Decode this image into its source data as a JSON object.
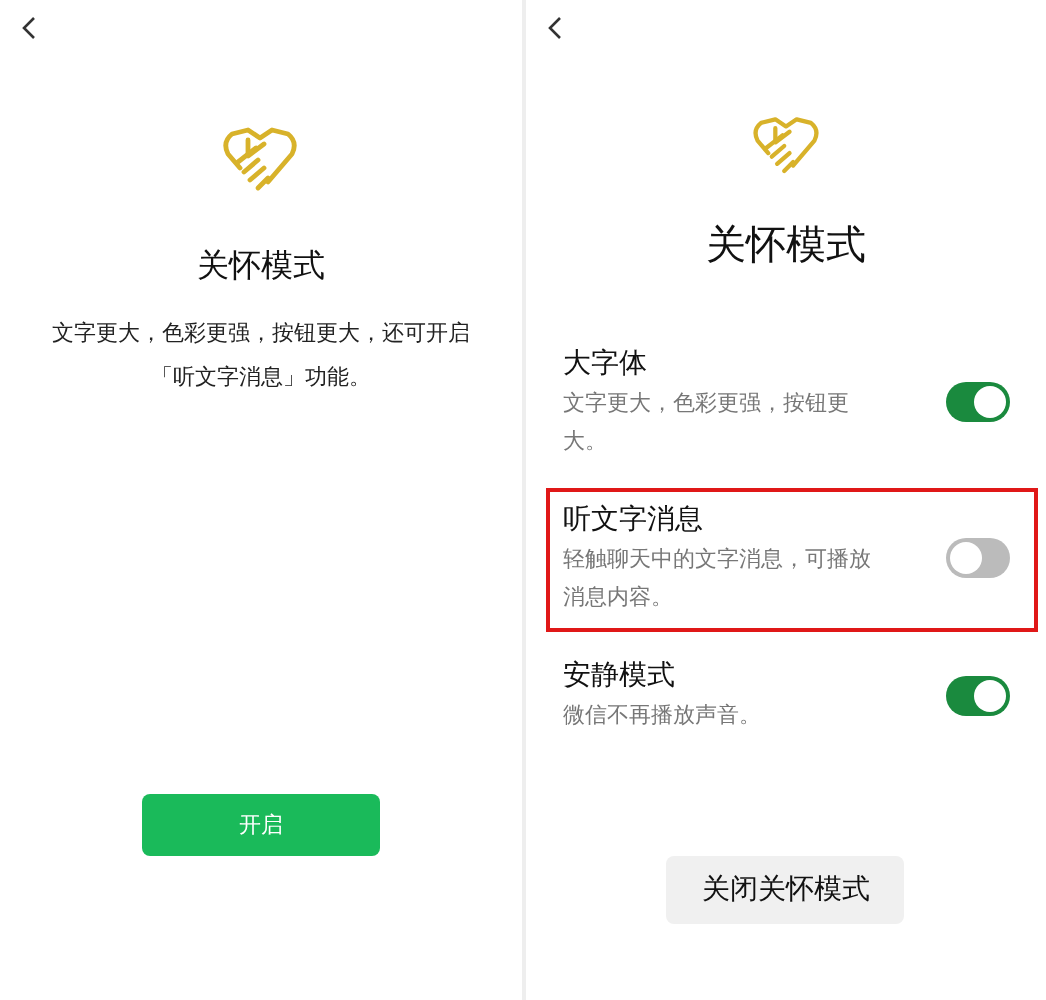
{
  "screens": [
    {
      "kind": "intro",
      "title": "关怀模式",
      "description": "文字更大，色彩更强，按钮更大，还可开启「听文字消息」功能。",
      "button": "开启"
    },
    {
      "kind": "settings",
      "title": "关怀模式",
      "options": [
        {
          "label": "大字体",
          "description": "文字更大，色彩更强，按钮更大。",
          "on": true,
          "highlighted": false
        },
        {
          "label": "听文字消息",
          "description": "轻触聊天中的文字消息，可播放消息内容。",
          "on": false,
          "highlighted": true
        },
        {
          "label": "安静模式",
          "description": "微信不再播放声音。",
          "on": true,
          "highlighted": false
        }
      ],
      "button": "关闭关怀模式"
    }
  ]
}
